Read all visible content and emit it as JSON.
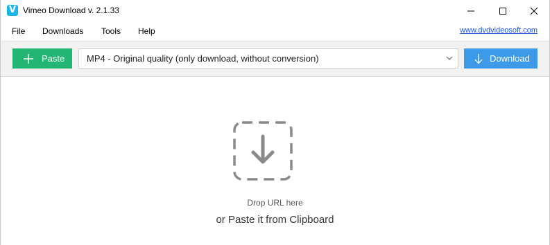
{
  "window": {
    "title": "Vimeo Download v. 2.1.33",
    "app_icon_glyph": "V",
    "controls": [
      "minimize-icon",
      "maximize-icon",
      "close-icon"
    ]
  },
  "menu": {
    "items": [
      "File",
      "Downloads",
      "Tools",
      "Help"
    ],
    "site_link": "www.dvdvideosoft.com"
  },
  "toolbar": {
    "paste_label": "Paste",
    "paste_icon": "plus-icon",
    "format_selected": "MP4 - Original quality (only download, without conversion)",
    "download_label": "Download",
    "download_icon": "arrow-down-icon"
  },
  "dropzone": {
    "icon": "download-drop-icon",
    "hint": "Drop URL here",
    "sub": "or Paste it from Clipboard"
  },
  "colors": {
    "paste_button": "#22b573",
    "download_button": "#3d9ae8",
    "toolbar_bg": "#f2f2f2",
    "link": "#1a58d6",
    "app_icon": "#1ab7ea",
    "drop_icon": "#8a8a8a"
  }
}
